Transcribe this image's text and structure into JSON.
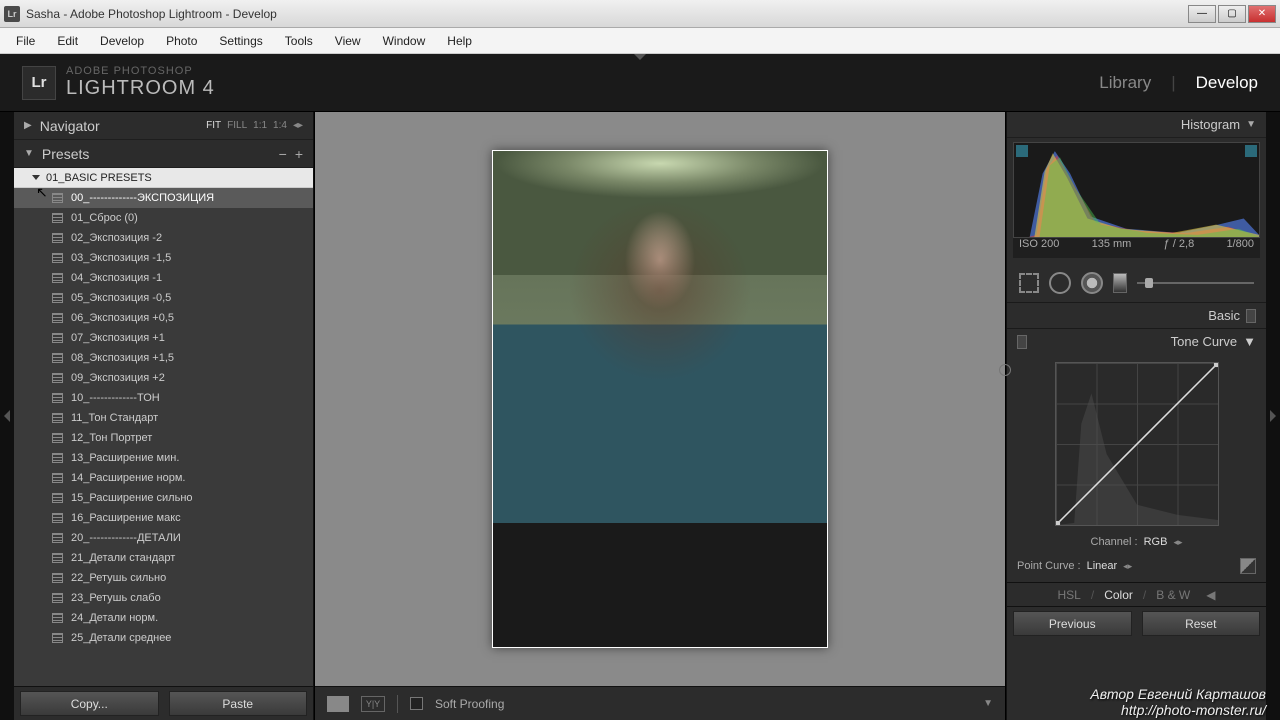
{
  "window": {
    "title": "Sasha - Adobe Photoshop Lightroom - Develop"
  },
  "menu": [
    "File",
    "Edit",
    "Develop",
    "Photo",
    "Settings",
    "Tools",
    "View",
    "Window",
    "Help"
  ],
  "branding": {
    "logo": "Lr",
    "line1": "ADOBE PHOTOSHOP",
    "line2": "LIGHTROOM 4"
  },
  "modules": {
    "library": "Library",
    "develop": "Develop"
  },
  "navigator": {
    "title": "Navigator",
    "modes": [
      "FIT",
      "FILL",
      "1:1",
      "1:4"
    ]
  },
  "presets": {
    "title": "Presets",
    "folder": "01_BASIC PRESETS",
    "items": [
      "00_-------------ЭКСПОЗИЦИЯ",
      "01_Сброс (0)",
      "02_Экспозиция -2",
      "03_Экспозиция -1,5",
      "04_Экспозиция -1",
      "05_Экспозиция -0,5",
      "06_Экспозиция +0,5",
      "07_Экспозиция +1",
      "08_Экспозиция +1,5",
      "09_Экспозиция +2",
      "10_-------------ТОН",
      "11_Тон Стандарт",
      "12_Тон Портрет",
      "13_Расширение мин.",
      "14_Расширение норм.",
      "15_Расширение сильно",
      "16_Расширение макс",
      "20_-------------ДЕТАЛИ",
      "21_Детали стандарт",
      "22_Ретушь сильно",
      "23_Ретушь слабо",
      "24_Детали норм.",
      "25_Детали среднее"
    ],
    "selected": 0
  },
  "buttons": {
    "copy": "Copy...",
    "paste": "Paste",
    "previous": "Previous",
    "reset": "Reset"
  },
  "toolbar": {
    "softproof": "Soft Proofing"
  },
  "histogram": {
    "title": "Histogram",
    "iso": "ISO 200",
    "focal": "135 mm",
    "aperture": "ƒ / 2,8",
    "shutter": "1/800"
  },
  "basic": {
    "title": "Basic"
  },
  "tonecurve": {
    "title": "Tone Curve",
    "channel_label": "Channel :",
    "channel": "RGB",
    "pointcurve_label": "Point Curve :",
    "pointcurve": "Linear"
  },
  "hsl": {
    "hsl": "HSL",
    "color": "Color",
    "bw": "B & W"
  },
  "watermark": {
    "line1": "Автор Евгений Карташов",
    "line2": "http://photo-monster.ru/"
  }
}
